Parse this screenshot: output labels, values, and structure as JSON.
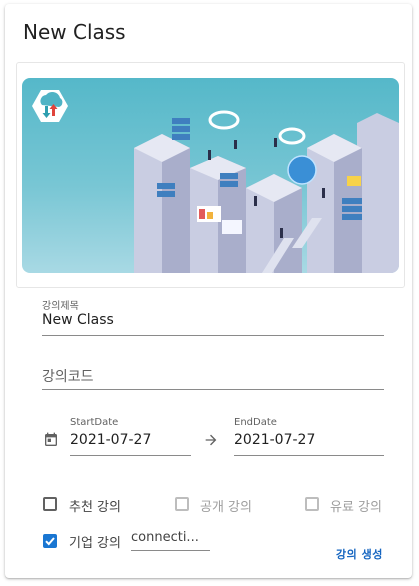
{
  "card": {
    "title": "New Class"
  },
  "form": {
    "title_field": {
      "label": "강의제목",
      "value": "New Class"
    },
    "code_field": {
      "placeholder": "강의코드"
    },
    "start_date": {
      "label": "StartDate",
      "value": "2021-07-27"
    },
    "end_date": {
      "label": "EndDate",
      "value": "2021-07-27"
    },
    "checkboxes": {
      "recommended": {
        "label": "추천 강의",
        "checked": false
      },
      "public": {
        "label": "공개 강의",
        "checked": false,
        "disabled": true
      },
      "paid": {
        "label": "유료 강의",
        "checked": false,
        "disabled": true
      },
      "corporate": {
        "label": "기업 강의",
        "checked": true
      }
    },
    "corporate_input": {
      "value": "connecti..."
    }
  },
  "actions": {
    "create_label": "강의 생성"
  },
  "colors": {
    "accent": "#1976d2",
    "image_bg": "#55b8c9"
  },
  "icons": {
    "calendar": "calendar-icon",
    "arrow": "arrow-right-icon",
    "logo": "cloud-sync-icon"
  }
}
